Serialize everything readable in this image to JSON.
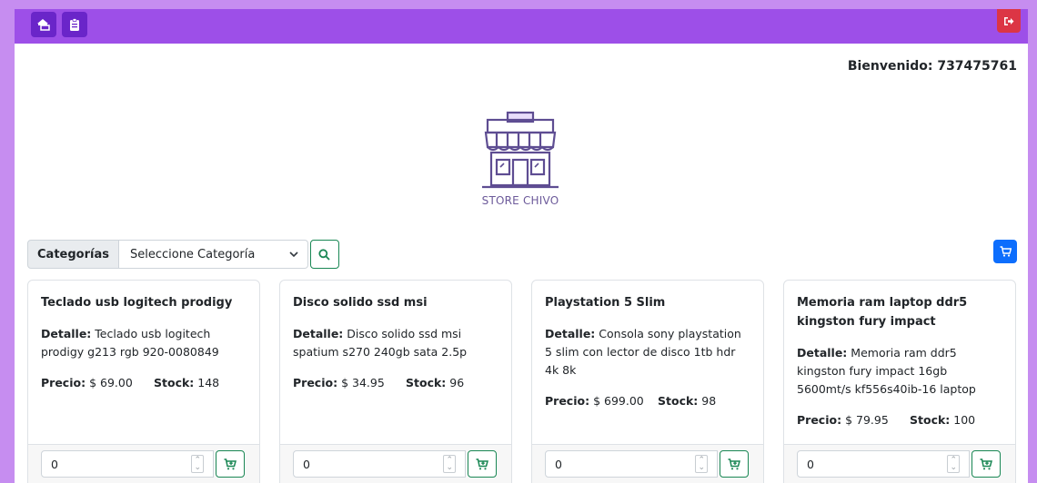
{
  "header": {
    "home_icon": "home-store-icon",
    "orders_icon": "clipboard-icon",
    "logout_icon": "logout-icon"
  },
  "welcome": {
    "text": "Bienvenido: 737475761"
  },
  "logo": {
    "text": "STORE CHIVO"
  },
  "filter": {
    "label": "Categorías",
    "selected": "Seleccione Categoría"
  },
  "colors": {
    "accent": "#9d4fe8",
    "dark_accent": "#6a25c9",
    "success": "#198754",
    "primary": "#0d6efd",
    "danger": "#dc3545"
  },
  "products": [
    {
      "title": "Teclado usb logitech prodigy",
      "detail_label": "Detalle:",
      "detail": "Teclado usb logitech prodigy g213 rgb 920-0080849",
      "price_label": "Precio:",
      "price": "$ 69.00",
      "stock_label": "Stock:",
      "stock": "148",
      "qty": "0"
    },
    {
      "title": "Disco solido ssd msi",
      "detail_label": "Detalle:",
      "detail": "Disco solido ssd msi spatium s270 240gb sata 2.5p",
      "price_label": "Precio:",
      "price": "$ 34.95",
      "stock_label": "Stock:",
      "stock": "96",
      "qty": "0"
    },
    {
      "title": "Playstation 5 Slim",
      "detail_label": "Detalle:",
      "detail": "Consola sony playstation 5 slim con lector de disco 1tb hdr 4k 8k",
      "price_label": "Precio:",
      "price": "$ 699.00",
      "stock_label": "Stock:",
      "stock": "98",
      "qty": "0"
    },
    {
      "title": "Memoria ram laptop ddr5 kingston fury impact",
      "detail_label": "Detalle:",
      "detail": "Memoria ram ddr5 kingston fury impact 16gb 5600mt/s kf556s40ib-16 laptop",
      "price_label": "Precio:",
      "price": "$ 79.95",
      "stock_label": "Stock:",
      "stock": "100",
      "qty": "0"
    }
  ]
}
